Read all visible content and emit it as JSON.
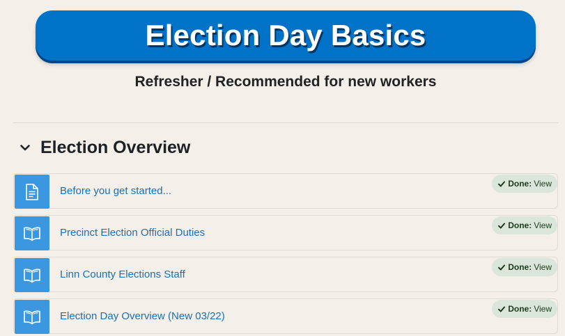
{
  "banner": {
    "title": "Election Day Basics"
  },
  "subtitle": "Refresher / Recommended for new workers",
  "section": {
    "title": "Election Overview",
    "activities": [
      {
        "label": "Before you get started...",
        "icon": "document-icon",
        "status_label": "Done:",
        "action_label": "View"
      },
      {
        "label": "Precinct Election Official Duties",
        "icon": "book-icon",
        "status_label": "Done:",
        "action_label": "View"
      },
      {
        "label": "Linn County Elections Staff",
        "icon": "book-icon",
        "status_label": "Done:",
        "action_label": "View"
      },
      {
        "label": "Election Day Overview (New 03/22)",
        "icon": "book-icon",
        "status_label": "Done:",
        "action_label": "View"
      }
    ]
  },
  "colors": {
    "accent": "#0073c8",
    "icon_bg": "#3a97e0",
    "link": "#1b6fb8",
    "done_badge": "#d9e6d9"
  }
}
